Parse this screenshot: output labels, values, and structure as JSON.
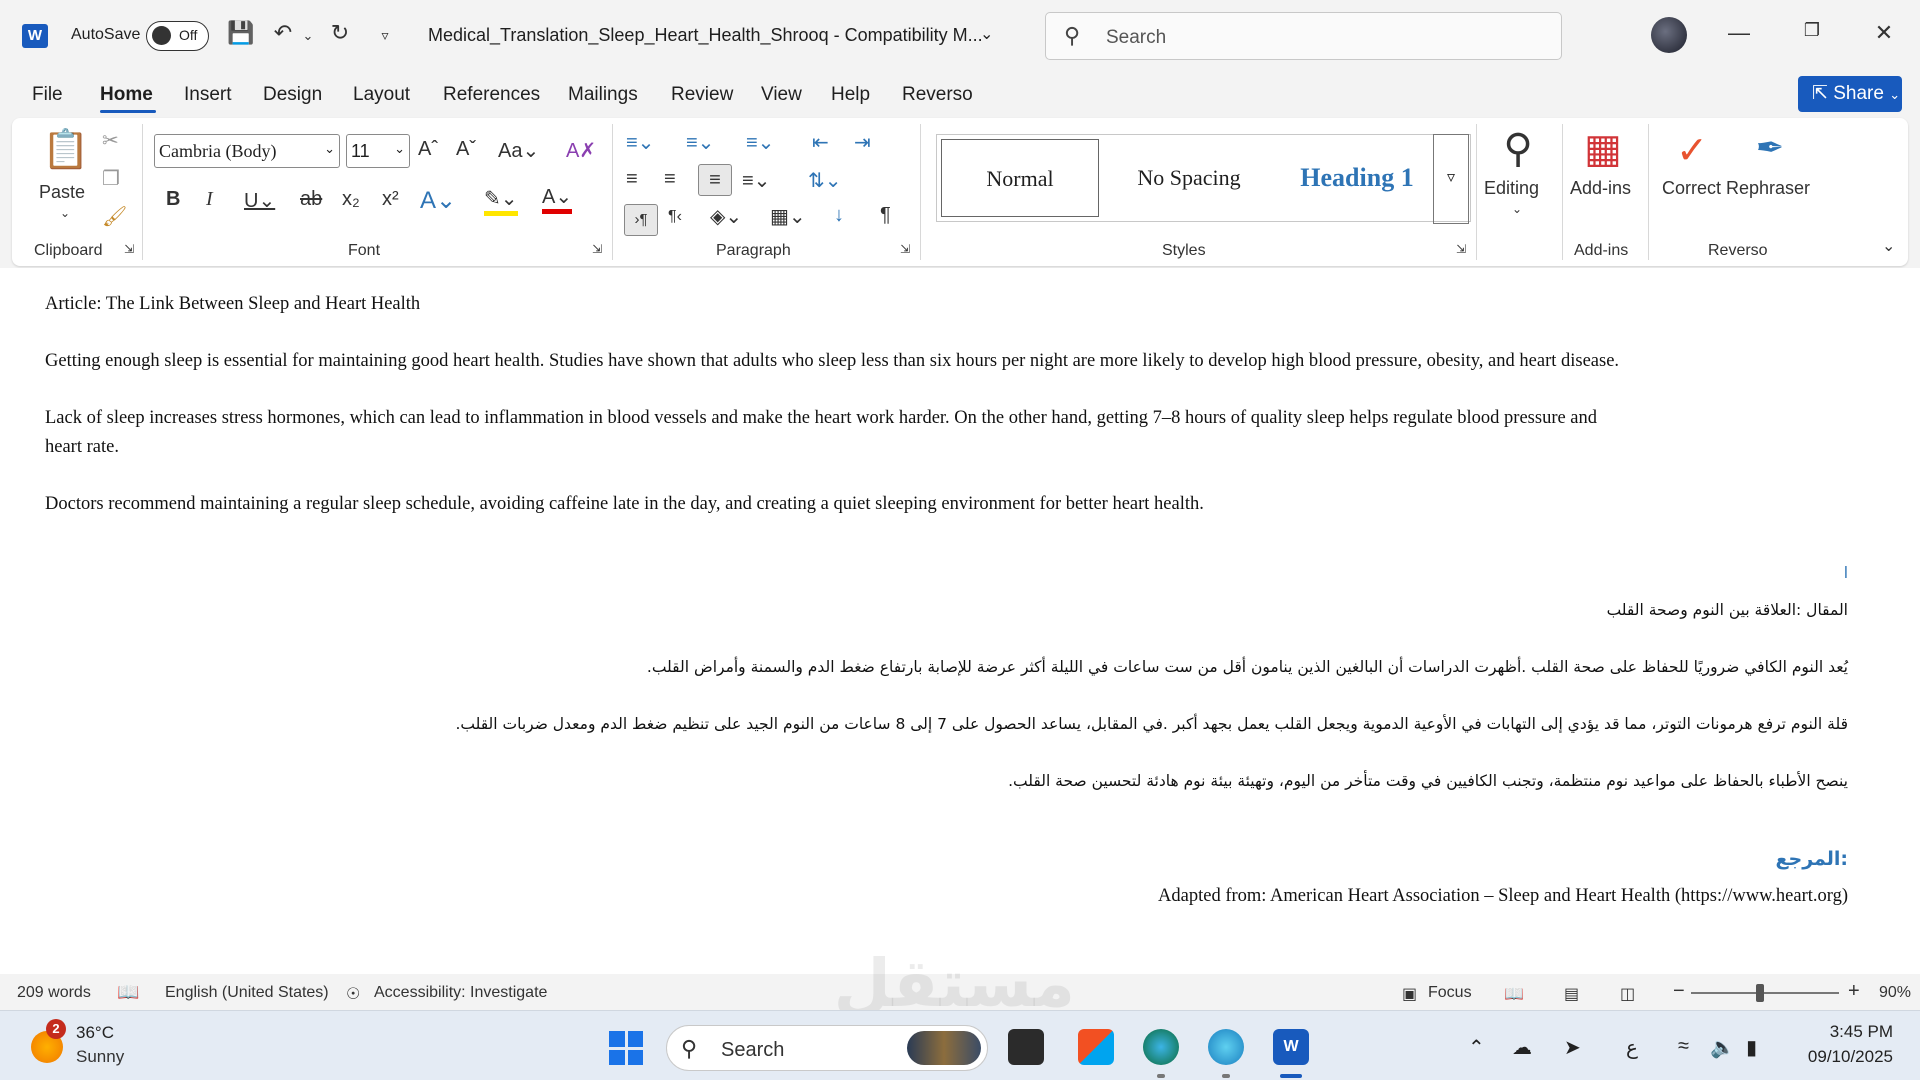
{
  "titlebar": {
    "autosave_label": "AutoSave",
    "autosave_state": "Off",
    "doc_title": "Medical_Translation_Sleep_Heart_Health_Shrooq  -  Compatibility M...",
    "search_placeholder": "Search"
  },
  "menu": {
    "tabs": [
      "File",
      "Home",
      "Insert",
      "Design",
      "Layout",
      "References",
      "Mailings",
      "Review",
      "View",
      "Help",
      "Reverso"
    ],
    "active": "Home",
    "share_label": "Share"
  },
  "ribbon": {
    "clipboard": {
      "paste_label": "Paste",
      "group_label": "Clipboard"
    },
    "font": {
      "family": "Cambria (Body)",
      "size": "11",
      "group_label": "Font"
    },
    "paragraph": {
      "group_label": "Paragraph"
    },
    "styles": {
      "items": [
        "Normal",
        "No Spacing",
        "Heading 1"
      ],
      "group_label": "Styles"
    },
    "editing": {
      "label": "Editing"
    },
    "addins": {
      "label": "Add-ins",
      "group_label": "Add-ins"
    },
    "reverso": {
      "correct_label": "Correct",
      "rephraser_label": "Rephraser",
      "group_label": "Reverso"
    }
  },
  "document": {
    "en_title": "Article: The Link Between Sleep and Heart Health",
    "en_p1": "Getting enough sleep is essential for maintaining good heart health. Studies have shown that adults who sleep less than six hours per night are more likely to develop high blood pressure, obesity, and heart disease.",
    "en_p2_line1": "Lack of sleep increases stress hormones, which can lead to inflammation in blood vessels and make the heart work harder. On the other hand, getting 7–8 hours of quality sleep helps regulate blood pressure and",
    "en_p2_line2": "heart rate.",
    "en_p3": "Doctors recommend maintaining a regular sleep schedule, avoiding caffeine late in the day, and creating a quiet sleeping environment for better heart health.",
    "ar_mark": "ا",
    "ar_title": "المقال :العلاقة بين النوم وصحة القلب",
    "ar_p1": "يُعد النوم الكافي ضروريًا للحفاظ على صحة القلب .أظهرت الدراسات أن البالغين الذين ينامون أقل من ست ساعات في الليلة أكثر عرضة للإصابة بارتفاع ضغط الدم والسمنة وأمراض القلب.",
    "ar_p2": "قلة النوم ترفع هرمونات التوتر، مما قد يؤدي إلى التهابات في الأوعية الدموية ويجعل القلب يعمل بجهد أكبر .في المقابل، يساعد الحصول على 7 إلى 8 ساعات من النوم الجيد على تنظيم ضغط الدم ومعدل ضربات القلب.",
    "ar_p3": "ينصح الأطباء بالحفاظ على مواعيد نوم منتظمة، وتجنب الكافيين في وقت متأخر من اليوم، وتهيئة بيئة نوم هادئة لتحسين صحة القلب.",
    "ar_ref_heading": ":المرجع",
    "ref_line": "Adapted from: American Heart Association – Sleep and Heart Health (https://www.heart.org)"
  },
  "status": {
    "words": "209 words",
    "language": "English (United States)",
    "accessibility": "Accessibility: Investigate",
    "focus": "Focus",
    "zoom": "90%"
  },
  "taskbar": {
    "weather_badge": "2",
    "temp": "36°C",
    "condition": "Sunny",
    "search": "Search",
    "ime": "ع",
    "time": "3:45 PM",
    "date": "09/10/2025"
  },
  "watermark": "مستقل",
  "colors": {
    "accent": "#185abd",
    "heading": "#2e74b5",
    "ribbon_bg": "#ffffff",
    "chrome_bg": "#f3f3f3"
  }
}
